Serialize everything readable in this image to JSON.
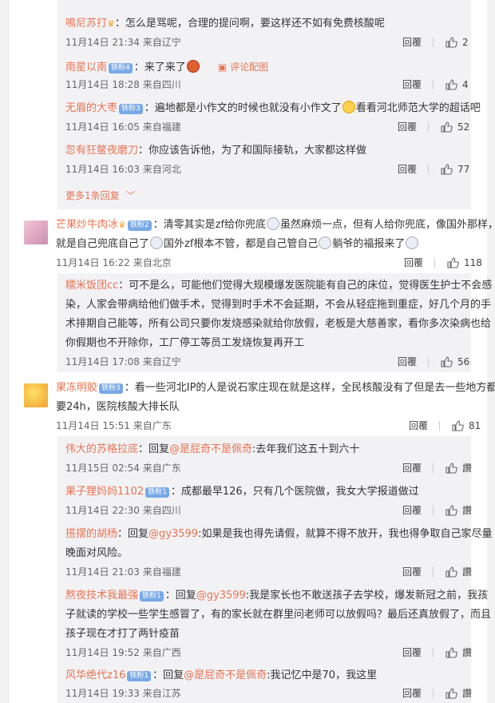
{
  "actions": {
    "reply": "回覆"
  },
  "colors": {
    "name": "#eb7350",
    "badge": "#78a9e6",
    "box": "#f2f2f5"
  },
  "group1": {
    "replies": [
      {
        "name": "鳴尼苏打",
        "text": "怎么是骂呢，合理的提问啊，要这样还不如有免费核酸呢",
        "meta": "11月14日 21:34 来自辽宁",
        "likes": "2"
      },
      {
        "name": "南星以南",
        "badge": "铁粉4",
        "text": "来了来了",
        "pic": "评论配图",
        "meta": "11月14日 18:28 来自四川",
        "likes": "4"
      },
      {
        "name": "无眉的大枣",
        "badge": "铁粉3",
        "text_a": "遍地都是小作文的时候也就没有小作文了",
        "text_b": "看看河北师范大学的超话吧",
        "meta": "11月14日 16:05 来自福建",
        "likes": "52"
      },
      {
        "name": "忽有狂鳖夜磨刀",
        "text": "你应该告诉他，为了和国际接轨，大家都这样做",
        "meta": "11月14日 16:03 来自河北",
        "likes": "77"
      }
    ],
    "more": "更多1条回复"
  },
  "comment2": {
    "name": "芒果炒牛肉冰",
    "badge": "铁粉2",
    "line1_a": "清零其实是zf给你兜底",
    "line1_b": "虽然麻烦一点，但有人给你兜底，像国外那样，",
    "line2_a": "就是自己兜底自己了",
    "line2_b": "国外zf根本不管，都是自己管自己",
    "line2_c": "躺爷的福报来了",
    "meta": "11月14日 16:22 来自北京",
    "likes": "118",
    "reply": {
      "name": "糯米饭团cc",
      "lines": [
        "：可不是么，可能他们觉得大规模爆发医院能有自己的床位，觉得医生护士不会感",
        "染，人家会带病给他们做手术，觉得到时手术不会延期，不会从轻症拖到重症，好几个月的手",
        "术排期自己能等，所有公司只要你发烧感染就给你放假，老板是大慈善家，看你多次染病也给",
        "你假期也不开除你，工厂停工等员工发烧恢复再开工"
      ],
      "meta": "11月14日 17:08 来自辽宁",
      "likes": "56"
    }
  },
  "comment3": {
    "name": "果冻明胶",
    "badge": "铁粉3",
    "line1": "：看一些河北IP的人是说石家庄现在就是这样，全民核酸没有了但是去一些地方都",
    "line2": "要24h，医院核酸大排长队",
    "meta": "11月14日 15:51 来自广东",
    "likes": "81",
    "replies": [
      {
        "name": "伟大的苏格拉底",
        "text_a": "：回复",
        "mention": "@是屁奇不是佩奇",
        "text_b": ":去年我们这五十到六十",
        "meta": "11月15日 02:54 来自广东",
        "likes": "讚"
      },
      {
        "name": "果子狸妈妈1102",
        "badge": "铁粉1",
        "text": "：成都最早126，只有几个医院做，我女大学报道做过",
        "meta": "11月14日 22:30 来自四川",
        "likes": "讚"
      },
      {
        "name": "搭摆的胡杨",
        "text_a": "：回复",
        "mention": "@gy3599",
        "text_b": ":如果是我也得先请假，就算不得不放开，我也得争取自己家尽量",
        "line2": "晚面对风险。",
        "meta": "11月14日 21:03 来自福建",
        "likes": "讚"
      },
      {
        "name": "熬夜技术我最强",
        "badge": "铁粉1",
        "text_a": "：回复",
        "mention": "@gy3599",
        "text_b": ":我是家长也不敢送孩子去学校，爆发新冠之前，我孩",
        "line2": "子就读的学校一些学生感冒了，有的家长就在群里问老师可以放假吗？最后还真放假了，而且",
        "line3": "孩子现在才打了两针疫苗",
        "meta": "11月14日 19:52 来自广西",
        "likes": "讚"
      },
      {
        "name": "风华绝代z16",
        "badge": "铁粉1",
        "text_a": "：回复",
        "mention": "@是屁奇不是佩奇",
        "text_b": ":我记忆中是70，我这里",
        "meta": "11月14日 19:33 来自江苏",
        "likes": "讚"
      }
    ]
  }
}
